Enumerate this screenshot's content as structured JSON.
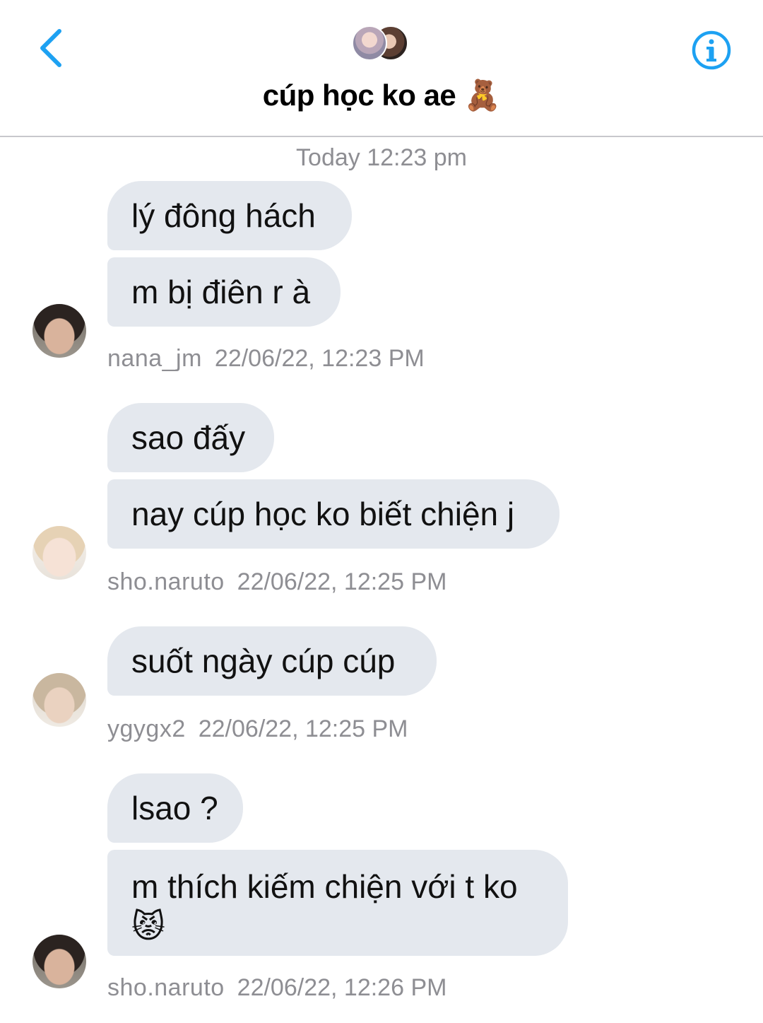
{
  "header": {
    "title": "cúp học ko ae",
    "title_emoji": "🧸",
    "back_icon": "chevron-left-icon",
    "info_icon": "info-circle-icon",
    "accent_color": "#1da1f2"
  },
  "conversation": {
    "timestamp": "Today 12:23 pm",
    "groups": [
      {
        "user": "nana_jm",
        "time": "22/06/22, 12:23 PM",
        "messages": [
          "lý đông hách",
          "m bị điên r à"
        ]
      },
      {
        "user": "sho.naruto",
        "time": "22/06/22, 12:25 PM",
        "messages": [
          "sao đấy",
          "nay cúp học ko biết chiện j"
        ]
      },
      {
        "user": "ygygx2",
        "time": "22/06/22, 12:25 PM",
        "messages": [
          "suốt ngày cúp cúp"
        ]
      },
      {
        "user": "sho.naruto",
        "time": "22/06/22, 12:26 PM",
        "messages": [
          "lsao ?",
          "m thích kiếm chiện với t ko",
          "😾"
        ]
      }
    ]
  },
  "colors": {
    "bubble": "#e4e8ee",
    "meta_text": "#8e8e93"
  }
}
